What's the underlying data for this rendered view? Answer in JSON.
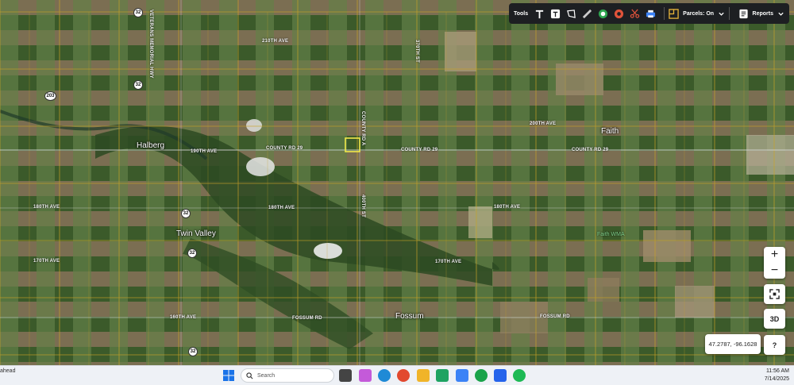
{
  "toolbar": {
    "tools_label": "Tools",
    "parcels_label": "Parcels: On",
    "reports_label": "Reports"
  },
  "map": {
    "towns": [
      "Halberg",
      "Twin Valley",
      "Faith",
      "Fossum"
    ],
    "poi": "Faith WMA",
    "roads": {
      "county_rd_29_west": "COUNTY RD 29",
      "county_rd_29_mid": "COUNTY RD 29",
      "county_rd_29_east": "COUNTY RD 29",
      "ave_190th": "190TH AVE",
      "ave_180th_w": "180TH AVE",
      "ave_180th_mid": "180TH AVE",
      "ave_180th_e": "180TH AVE",
      "ave_170th_w": "170TH AVE",
      "ave_170th_mid": "170TH AVE",
      "ave_160th": "160TH AVE",
      "fossum_rd_w": "FOSSUM RD",
      "fossum_rd_e": "FOSSUM RD",
      "ave_200th": "200TH AVE",
      "ave_210th": "210TH AVE",
      "veterans": "VETERANS MEMORIAL HWY",
      "county_rd_a": "COUNTY RD A",
      "st_370th": "370TH ST",
      "st_400th": "400TH ST"
    },
    "shields": [
      "32",
      "32",
      "203",
      "32",
      "32",
      "32"
    ]
  },
  "controls": {
    "zoom_in": "+",
    "zoom_out": "−",
    "three_d": "3D",
    "help": "?",
    "coords": "47.2787, -96.1628"
  },
  "taskbar": {
    "left_text": "ahead",
    "search_placeholder": "Search",
    "time": "11:56 AM",
    "date": "7/14/2025"
  },
  "colors": {
    "parcel_line": "#c9a227",
    "selected_parcel": "#f1e94b",
    "toolbar_bg": "#1d1f22"
  }
}
